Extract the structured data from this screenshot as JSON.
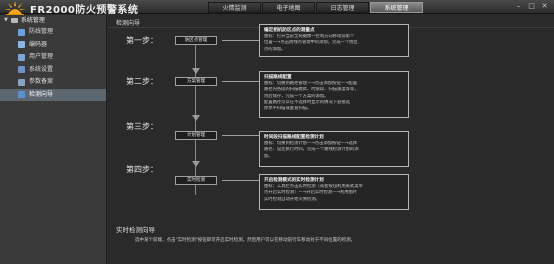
{
  "header": {
    "app_title": "FR2000防火预警系统",
    "tabs": [
      {
        "label": "火情监测",
        "active": false
      },
      {
        "label": "电子地图",
        "active": false
      },
      {
        "label": "日志管理",
        "active": false
      },
      {
        "label": "系统管理",
        "active": true
      }
    ],
    "window_controls": {
      "minimize": "–",
      "maximize": "□",
      "close": "✕"
    }
  },
  "sidebar": {
    "root_label": "系统管理",
    "items": [
      {
        "label": "防线管理",
        "icon": "shield-icon",
        "color": "#6fa0d8",
        "selected": false
      },
      {
        "label": "编码器",
        "icon": "encoder-icon",
        "color": "#8fb6e0",
        "selected": false
      },
      {
        "label": "用户管理",
        "icon": "users-icon",
        "color": "#7aa7d6",
        "selected": false
      },
      {
        "label": "系统设置",
        "icon": "settings-icon",
        "color": "#6f93c4",
        "selected": false
      },
      {
        "label": "参数备案",
        "icon": "archive-icon",
        "color": "#8aa2c0",
        "selected": false
      },
      {
        "label": "检测向导",
        "icon": "wizard-icon",
        "color": "#5c8fd0",
        "selected": true
      }
    ]
  },
  "main": {
    "title": "检测向导",
    "steps": [
      {
        "step_label": "第一步：",
        "box_label": "防区点管理",
        "desc_title": "编定相机防区点的测量点",
        "desc_lines": [
          "图标：打开当前全局摄像一控制方向移动前第个",
          "位置—→点击防线点管理中的添加，完成一个防区",
          "点的添加。"
        ]
      },
      {
        "step_label": "第二步：",
        "box_label": "方案管理",
        "desc_title": "扫描路线配置",
        "desc_lines": [
          "图标：切换到路径管理—→点击添加按钮—→配置",
          "路径内各段的扫描模式、时限段、扫描速度等等，",
          "然后保存，完成一个方案的添加。",
          "  配置路径可以在不选择时显示的情况下直接选",
          "择水平扫描或垂直扫描。"
        ]
      },
      {
        "step_label": "第三步：",
        "box_label": "计划管理",
        "desc_title": "时间段扫描路线配置检测计划",
        "desc_lines": [
          "图标：切换到检测计划—→点击添加按钮—→选择",
          "路径、设定执行时间，完成一个路线检测计划的添",
          "加。"
        ]
      },
      {
        "step_label": "第四步：",
        "box_label": "实时检测",
        "desc_title": "开启检测模式的实时检测计划",
        "desc_lines": [
          "图标：工具栏点击实时检测（或者按钮利用表式菜单",
          "点开启实时检测）—→开启实时检测—→利用图片",
          "实时检测自动开始火情检测。"
        ]
      }
    ],
    "realtime_title": "实时检测向导",
    "realtime_desc": "选中某个前端，点击\"实时检测\"按钮即可开启实时检测，然后用户可以在移动前行车移动对于不同位置的检测。"
  }
}
